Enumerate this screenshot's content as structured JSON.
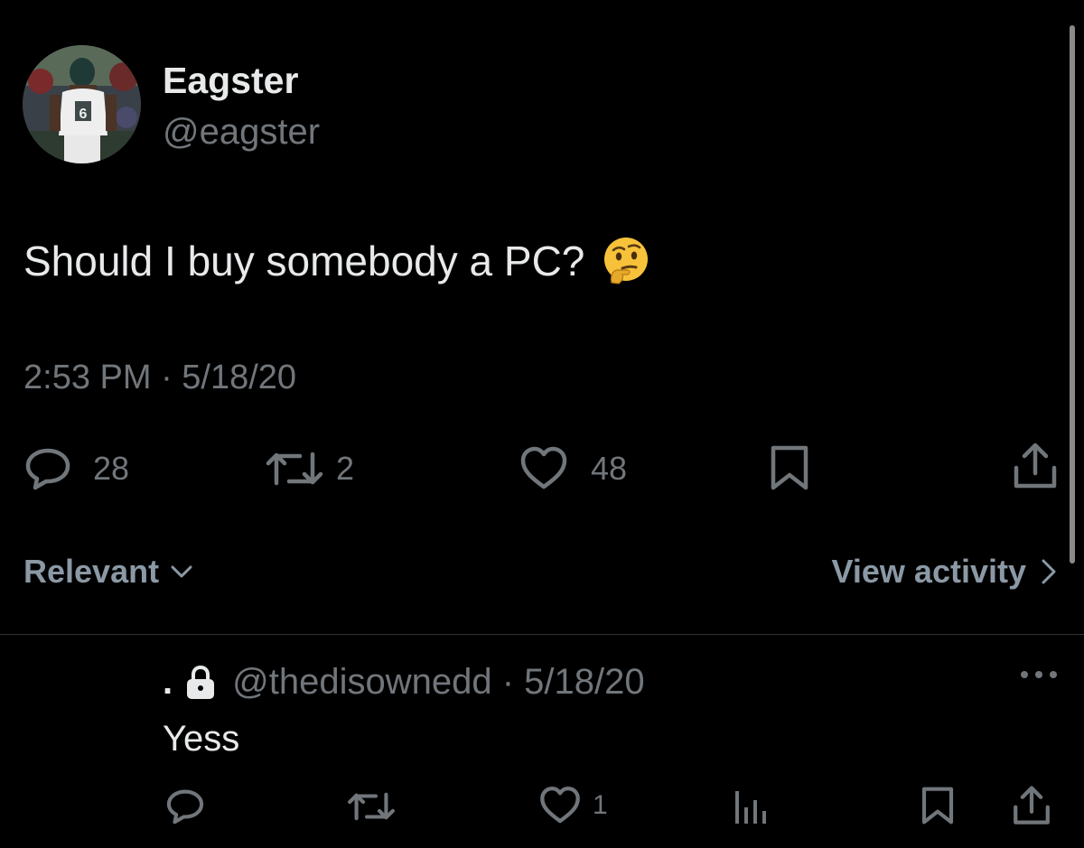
{
  "tweet": {
    "display_name": "Eagster",
    "handle": "@eagster",
    "text": "Should I buy somebody a PC?",
    "emoji": "thinking-face",
    "timestamp": "2:53 PM · 5/18/20",
    "metrics": {
      "replies": "28",
      "retweets": "2",
      "likes": "48"
    }
  },
  "replies_section": {
    "sort_label": "Relevant",
    "view_activity_label": "View activity"
  },
  "reply": {
    "name": ".",
    "handle_date": "@thedisownedd · 5/18/20",
    "text": "Yess",
    "likes": "1"
  },
  "colors": {
    "background": "#000000",
    "primary_text": "#e7e9ea",
    "secondary_text": "#71767b",
    "divider": "#2f3336"
  }
}
